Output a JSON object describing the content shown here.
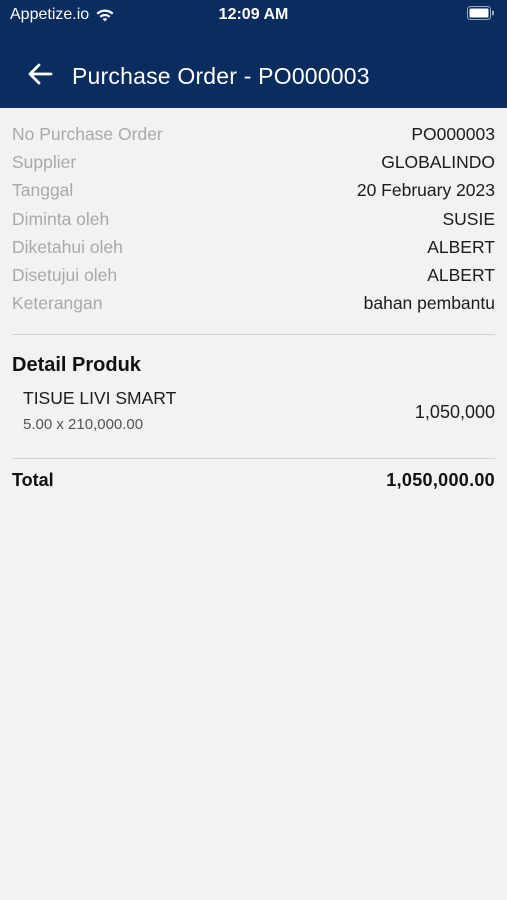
{
  "status_bar": {
    "carrier": "Appetize.io",
    "time": "12:09 AM"
  },
  "header": {
    "title": "Purchase Order - PO000003",
    "background": "#0a2c5e"
  },
  "info": [
    {
      "label": "No Purchase Order",
      "value": "PO000003"
    },
    {
      "label": "Supplier",
      "value": "GLOBALINDO"
    },
    {
      "label": "Tanggal",
      "value": "20 February 2023"
    },
    {
      "label": "Diminta oleh",
      "value": "SUSIE"
    },
    {
      "label": "Diketahui oleh",
      "value": "ALBERT"
    },
    {
      "label": "Disetujui oleh",
      "value": "ALBERT"
    },
    {
      "label": "Keterangan",
      "value": "bahan pembantu"
    }
  ],
  "detail": {
    "title": "Detail Produk",
    "items": [
      {
        "name": "TISUE LIVI SMART",
        "calc": "5.00 x 210,000.00",
        "amount": "1,050,000"
      }
    ]
  },
  "total": {
    "label": "Total",
    "value": "1,050,000.00"
  }
}
